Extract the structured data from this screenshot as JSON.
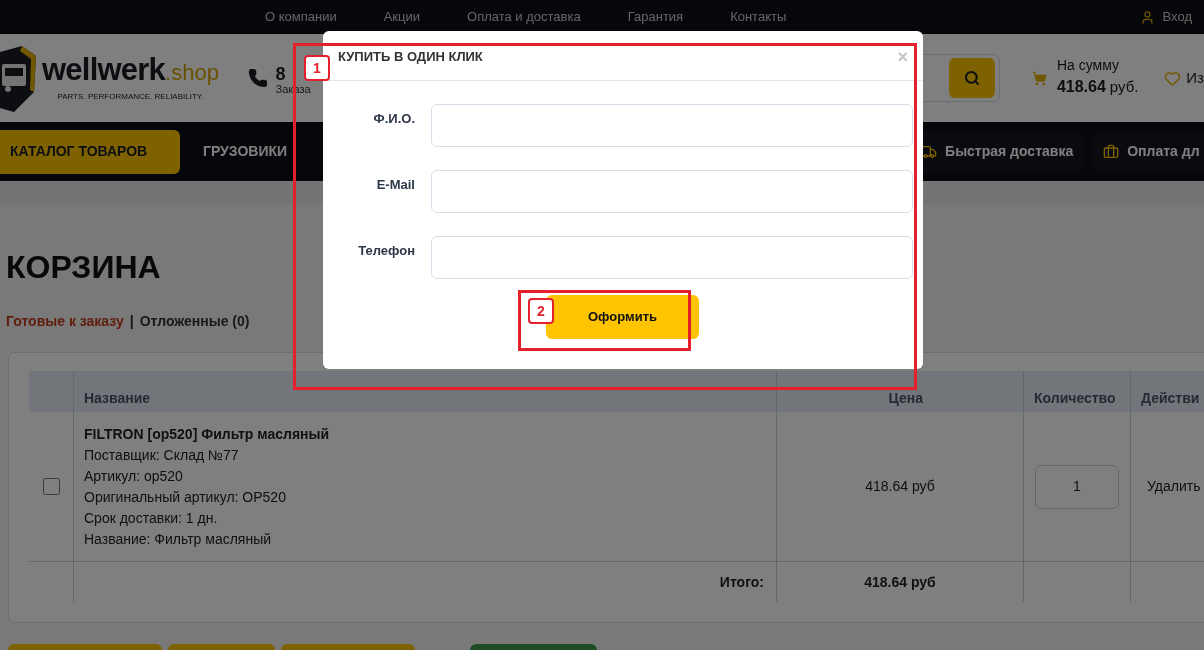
{
  "top_bar": {
    "links": [
      "О компании",
      "Акции",
      "Оплата и доставка",
      "Гарантия",
      "Контакты"
    ],
    "login": "Вход"
  },
  "header": {
    "logo": {
      "name": "wellwerk",
      "suffix": ".shop",
      "tagline": "PARTS. PERFORMANCE. RELIABILITY."
    },
    "phone": "8",
    "phone_note": "Заказа",
    "cart": {
      "label": "На сумму",
      "amount": "418.64",
      "currency": "руб."
    },
    "favorites": "Из"
  },
  "nav": {
    "catalog": "КАТАЛОГ ТОВАРОВ",
    "items": [
      "ГРУЗОВИКИ"
    ],
    "features": [
      {
        "label": "Быстрая доставка",
        "kind": "truck"
      },
      {
        "label": "Оплата дл",
        "kind": "briefcase"
      }
    ]
  },
  "page": {
    "title": "КОРЗИНА",
    "tabs": [
      {
        "label": "Готовые к заказу",
        "selected": true
      },
      {
        "label": "Отложенные (0)",
        "selected": false
      }
    ],
    "separator": "|"
  },
  "table": {
    "columns": [
      "Название",
      "Цена",
      "Количество",
      "Действи"
    ],
    "rows": [
      {
        "checked": false,
        "title": "FILTRON [op520] Фильтр масляный",
        "details": [
          "Поставщик: Склад №77",
          "Артикул: op520",
          "Оригинальный артикул: OP520",
          "Срок доставки: 1 дн.",
          "Название: Фильтр масляный"
        ],
        "price": "418.64 руб",
        "quantity": "1",
        "action": "Удалить"
      }
    ],
    "total_label": "Итого:",
    "total": "418.64 руб"
  },
  "bottom_buttons": [
    {
      "kind": "primary"
    },
    {
      "kind": "primary"
    },
    {
      "kind": "primary"
    },
    {
      "kind": "success"
    }
  ],
  "modal": {
    "title": "КУПИТЬ В ОДИН КЛИК",
    "close": "×",
    "fields": [
      {
        "label": "Ф.И.О."
      },
      {
        "label": "E-Mail"
      },
      {
        "label": "Телефон"
      }
    ],
    "submit": "Оформить"
  },
  "annotations": [
    {
      "label": "1"
    },
    {
      "label": "2"
    }
  ]
}
